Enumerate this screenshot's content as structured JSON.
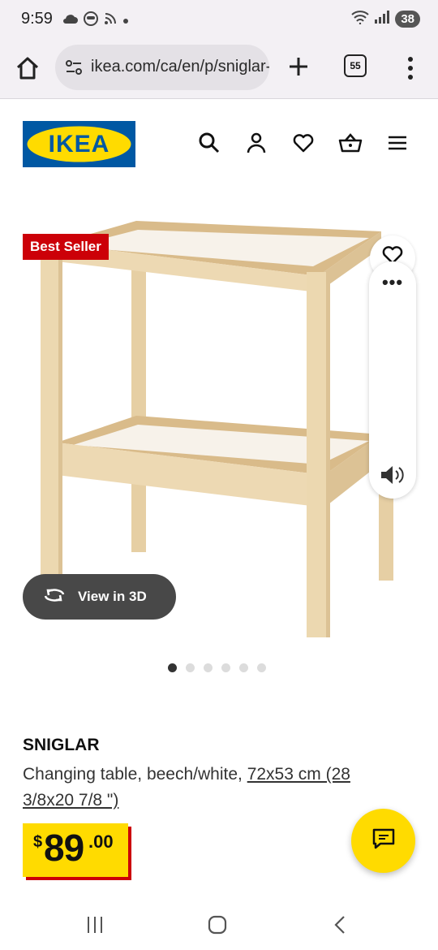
{
  "status_bar": {
    "time": "9:59",
    "battery": "38",
    "icons_left": [
      "cloud-icon",
      "shield-face-icon",
      "rss-icon",
      "dot-icon"
    ],
    "icons_right": [
      "wifi-icon",
      "signal-icon",
      "battery-icon"
    ]
  },
  "browser": {
    "url": "ikea.com/ca/en/p/sniglar-changing-table",
    "tab_count": "55",
    "icons": [
      "home-icon",
      "site-settings-icon",
      "plus-icon",
      "tabs-icon",
      "more-vert-icon"
    ]
  },
  "header": {
    "logo_text": "IKEA",
    "icons": [
      "search-icon",
      "account-icon",
      "heart-icon",
      "cart-icon",
      "menu-icon"
    ]
  },
  "product": {
    "badge": "Best Seller",
    "view_3d_label": "View in 3D",
    "carousel": {
      "total": 6,
      "active": 1
    },
    "name": "SNIGLAR",
    "description": "Changing table, beech/white, ",
    "measurements": "72x53 cm (28 3/8x20 7/8 \")",
    "price": {
      "currency": "$",
      "dollars": "89",
      "cents": ".00"
    }
  },
  "colors": {
    "ikea_blue": "#0058a3",
    "ikea_yellow": "#ffdb00",
    "badge_red": "#cc0008",
    "view3d_bg": "#484848"
  },
  "nav_bar": {
    "icons": [
      "recents-icon",
      "home-circle-icon",
      "back-icon"
    ]
  }
}
